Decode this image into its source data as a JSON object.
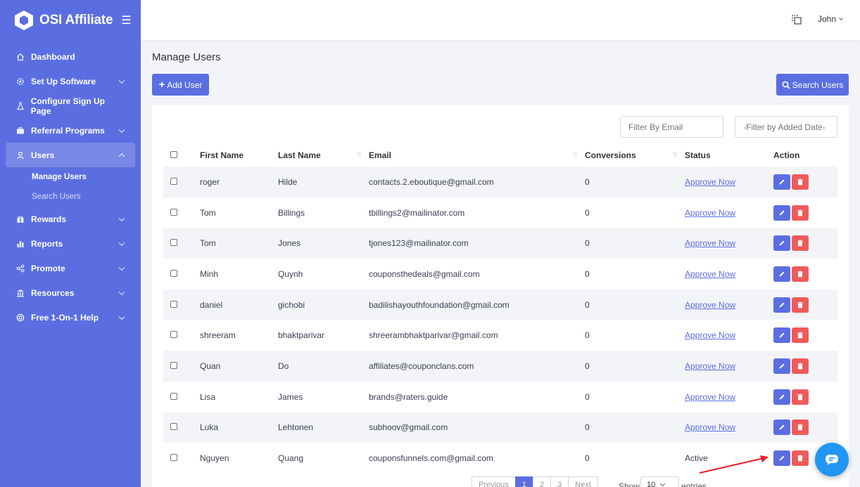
{
  "brand": {
    "name": "OSI Affiliate"
  },
  "topbar": {
    "user": "John"
  },
  "sidebar": {
    "items": [
      {
        "label": "Dashboard",
        "icon": "home-icon",
        "chevron": false
      },
      {
        "label": "Set Up Software",
        "icon": "gear-icon",
        "chevron": true
      },
      {
        "label": "Configure Sign Up Page",
        "icon": "flask-icon",
        "chevron": false
      },
      {
        "label": "Referral Programs",
        "icon": "briefcase-icon",
        "chevron": true
      },
      {
        "label": "Users",
        "icon": "user-icon",
        "chevron": true,
        "active": true
      },
      {
        "label": "Rewards",
        "icon": "gift-icon",
        "chevron": true
      },
      {
        "label": "Reports",
        "icon": "bar-chart-icon",
        "chevron": true
      },
      {
        "label": "Promote",
        "icon": "share-icon",
        "chevron": true
      },
      {
        "label": "Resources",
        "icon": "bank-icon",
        "chevron": true
      },
      {
        "label": "Free 1-On-1 Help",
        "icon": "support-icon",
        "chevron": true
      }
    ],
    "users_sub": [
      "Manage Users",
      "Search Users"
    ]
  },
  "main": {
    "title": "Manage Users",
    "add_button": "Add User",
    "search_button": "Search Users",
    "filter_email_placeholder": "Filter By Email",
    "filter_date_placeholder": "-Filter by Added Date-",
    "columns": [
      "First Name",
      "Last Name",
      "Email",
      "Conversions",
      "Status",
      "Action"
    ],
    "rows": [
      {
        "first": "roger",
        "last": "Hilde",
        "email": "contacts.2.eboutique@gmail.com",
        "conversions": "0",
        "status": "Approve Now"
      },
      {
        "first": "Tom",
        "last": "Billings",
        "email": "tbillings2@mailinator.com",
        "conversions": "0",
        "status": "Approve Now"
      },
      {
        "first": "Tom",
        "last": "Jones",
        "email": "tjones123@mailinator.com",
        "conversions": "0",
        "status": "Approve Now"
      },
      {
        "first": "Minh",
        "last": "Quynh",
        "email": "couponsthedeals@gmail.com",
        "conversions": "0",
        "status": "Approve Now"
      },
      {
        "first": "daniel",
        "last": "gichobi",
        "email": "badilishayouthfoundation@gmail.com",
        "conversions": "0",
        "status": "Approve Now"
      },
      {
        "first": "shreeram",
        "last": "bhaktparivar",
        "email": "shreerambhaktparivar@gmail.com",
        "conversions": "0",
        "status": "Approve Now"
      },
      {
        "first": "Quan",
        "last": "Do",
        "email": "affiliates@couponclans.com",
        "conversions": "0",
        "status": "Approve Now"
      },
      {
        "first": "Lisa",
        "last": "James",
        "email": "brands@raters.guide",
        "conversions": "0",
        "status": "Approve Now"
      },
      {
        "first": "Luka",
        "last": "Lehtonen",
        "email": "subhoov@gmail.com",
        "conversions": "0",
        "status": "Approve Now"
      },
      {
        "first": "Nguyen",
        "last": "Quang",
        "email": "couponsfunnels.com@gmail.com",
        "conversions": "0",
        "status": "Active"
      }
    ],
    "pagination": {
      "pages": [
        "Previous",
        "1",
        "2",
        "3",
        "Next"
      ],
      "current": "1"
    },
    "show_label": "Show",
    "show_value": "10",
    "entries_label": "entries"
  },
  "colors": {
    "primary": "#5b6ee1",
    "danger": "#ef5b5b",
    "annotation": "#e8202a",
    "chat": "#2196f3"
  }
}
